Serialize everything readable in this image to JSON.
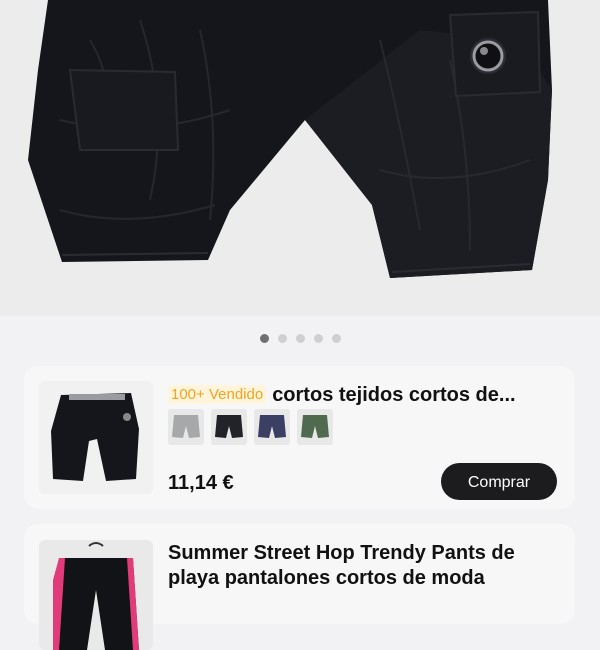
{
  "gallery": {
    "image": "black-nylon-cargo-shorts-photo",
    "dots_total": 5,
    "active_dot": 1
  },
  "products": [
    {
      "thumbnail": "black-shorts-thumbnail",
      "badge": "100+ Vendido",
      "title": "cortos tejidos cortos de...",
      "variants": [
        "grey",
        "black",
        "navy",
        "green"
      ],
      "price": "11,14 €",
      "buy_label": "Comprar"
    },
    {
      "thumbnail": "black-pink-striped-pants-thumbnail",
      "title": "Summer Street Hop Trendy Pants de playa pantalones cortos de moda"
    }
  ],
  "colors": {
    "badge_text": "#f3a31c",
    "button_bg": "#1c1c1e"
  }
}
